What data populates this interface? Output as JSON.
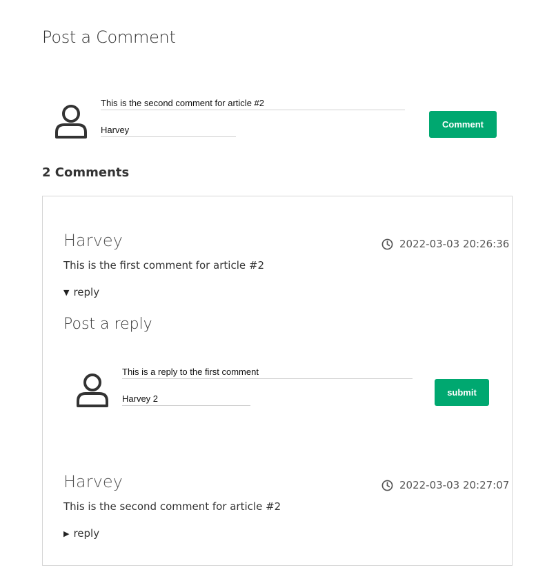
{
  "post_comment": {
    "title": "Post a Comment",
    "comment_value": "This is the second comment for article #2",
    "name_value": "Harvey",
    "button_label": "Comment"
  },
  "comments_section": {
    "count_label": "2 Comments",
    "comments": [
      {
        "author": "Harvey",
        "time": "2022-03-03 20:26:36",
        "text": "This is the first comment for article #2",
        "reply_toggle": {
          "glyph": "▼",
          "label": "reply",
          "expanded": true
        },
        "reply_form": {
          "title": "Post a reply",
          "reply_value": "This is a reply to the first comment",
          "name_value": "Harvey 2",
          "button_label": "submit"
        }
      },
      {
        "author": "Harvey",
        "time": "2022-03-03 20:27:07",
        "text": "This is the second comment for article #2",
        "reply_toggle": {
          "glyph": "▶",
          "label": "reply",
          "expanded": false
        }
      }
    ]
  },
  "colors": {
    "accent": "#00a870",
    "text": "#333333",
    "muted": "#555555",
    "border": "#d6d6d6"
  },
  "icons": {
    "avatar": "user-icon",
    "time": "clock-icon"
  }
}
